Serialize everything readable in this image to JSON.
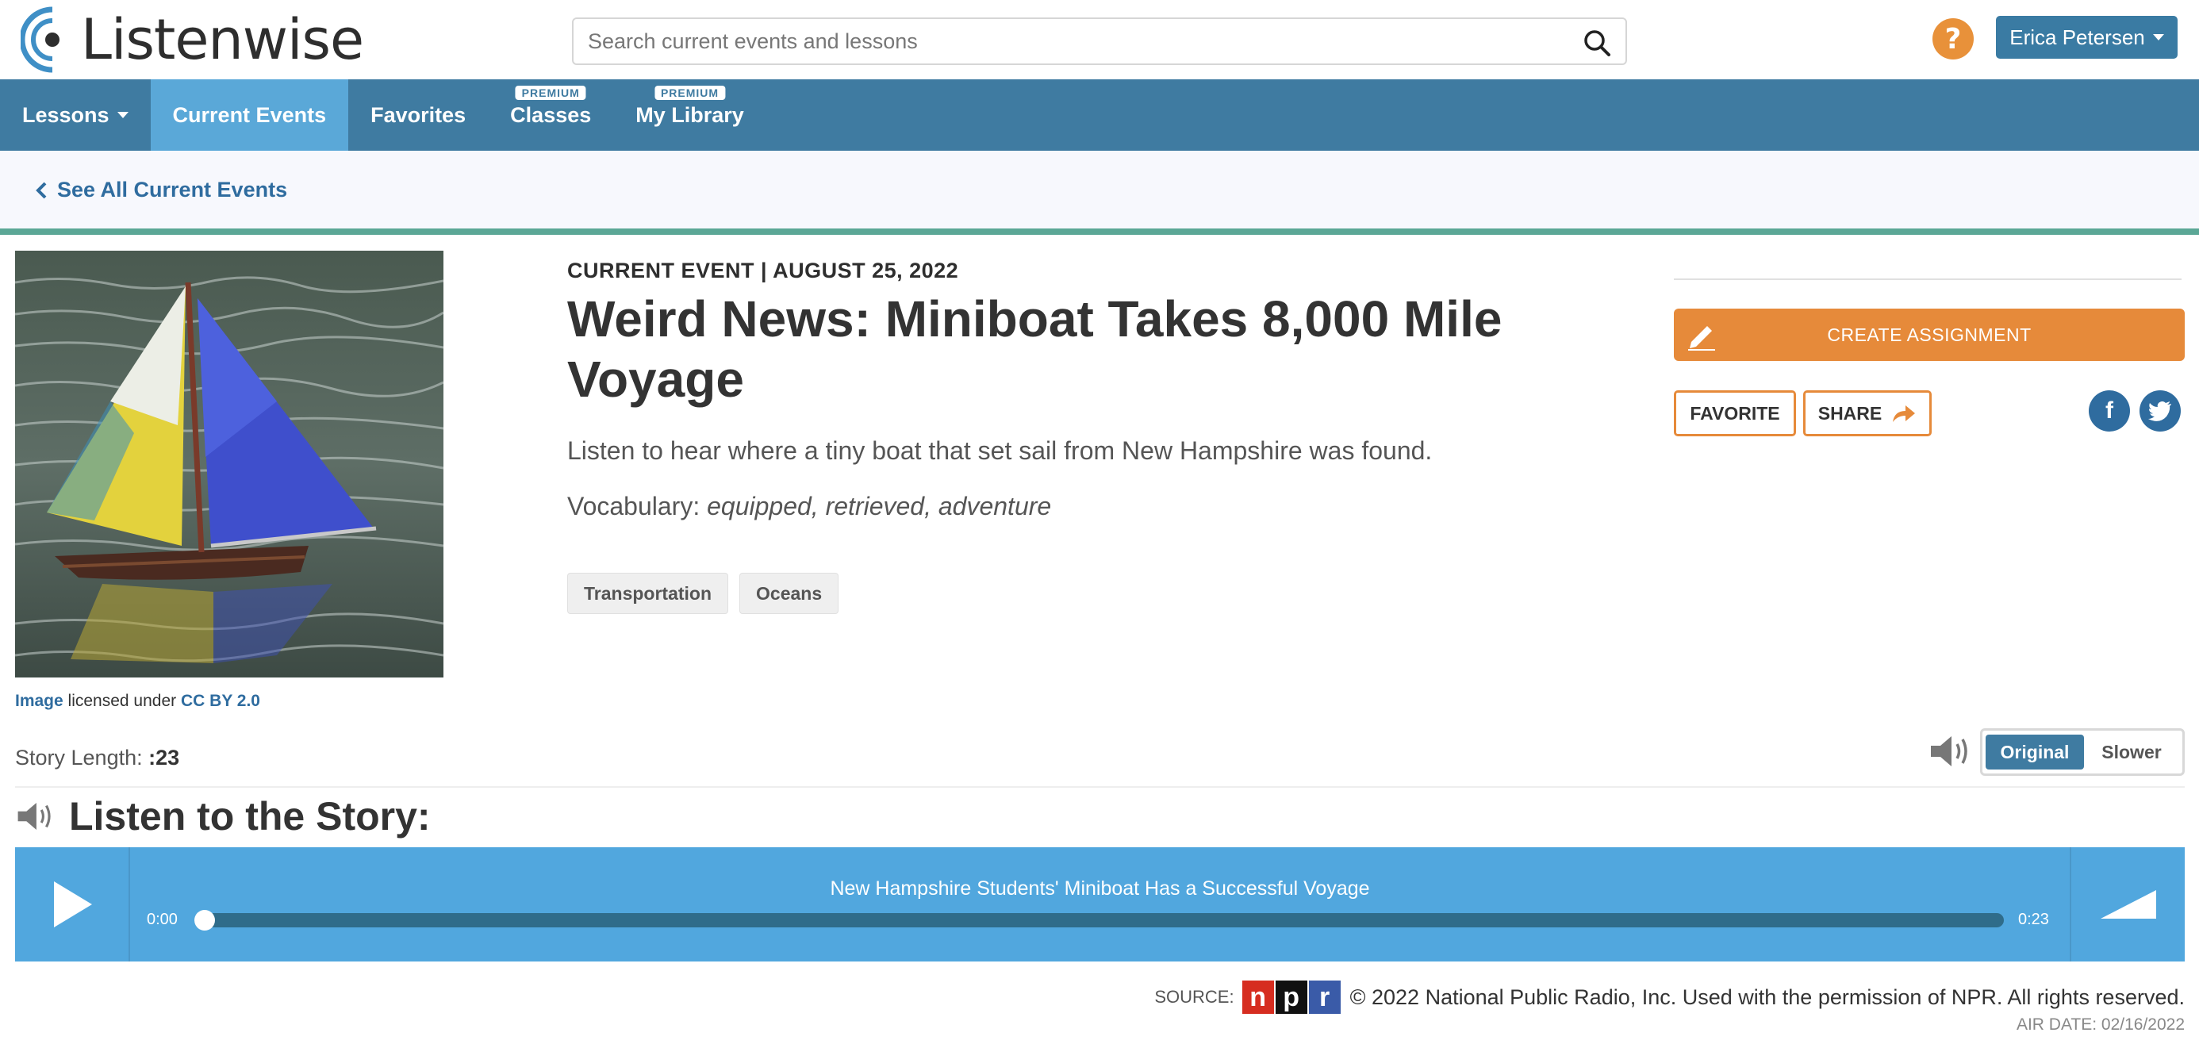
{
  "brand": {
    "name": "Listenwise"
  },
  "search": {
    "placeholder": "Search current events and lessons"
  },
  "header": {
    "help": "?",
    "user_name": "Erica Petersen"
  },
  "nav": {
    "items": [
      {
        "label": "Lessons"
      },
      {
        "label": "Current Events"
      },
      {
        "label": "Favorites"
      },
      {
        "label": "Classes",
        "badge": "PREMIUM"
      },
      {
        "label": "My Library",
        "badge": "PREMIUM"
      }
    ]
  },
  "breadcrumb": {
    "label": "See All Current Events"
  },
  "article": {
    "eyebrow": "CURRENT EVENT | AUGUST 25, 2022",
    "title": "Weird News: Miniboat Takes 8,000 Mile Voyage",
    "description": "Listen to hear where a tiny boat that set sail from New Hampshire was found.",
    "vocab_label": "Vocabulary:",
    "vocab_words": "equipped, retrieved, adventure",
    "tags": [
      "Transportation",
      "Oceans"
    ]
  },
  "image_credit": {
    "link": "Image",
    "middle": "licensed under",
    "license": "CC BY 2.0"
  },
  "actions": {
    "create_assignment": "CREATE ASSIGNMENT",
    "favorite": "FAVORITE",
    "share": "SHARE",
    "facebook": "f"
  },
  "story": {
    "length_label": "Story Length:",
    "length_value": ":23"
  },
  "speed": {
    "original": "Original",
    "slower": "Slower",
    "selected": "Original"
  },
  "listen": {
    "heading": "Listen to the Story:"
  },
  "player": {
    "track_title": "New Hampshire Students' Miniboat Has a Successful Voyage",
    "current_time": "0:00",
    "duration": "0:23",
    "progress": 0
  },
  "source": {
    "label": "SOURCE:",
    "logo_letters": [
      "n",
      "p",
      "r"
    ],
    "copyright": "© 2022 National Public Radio, Inc. Used with the permission of NPR. All rights reserved.",
    "air_date": "AIR DATE: 02/16/2022"
  },
  "colors": {
    "nav": "#3f7ba1",
    "nav_active": "#5aa8d8",
    "accent_orange": "#e68a3a",
    "link": "#2f6c9f",
    "player": "#51a7de",
    "rule_green": "#5ba796"
  }
}
